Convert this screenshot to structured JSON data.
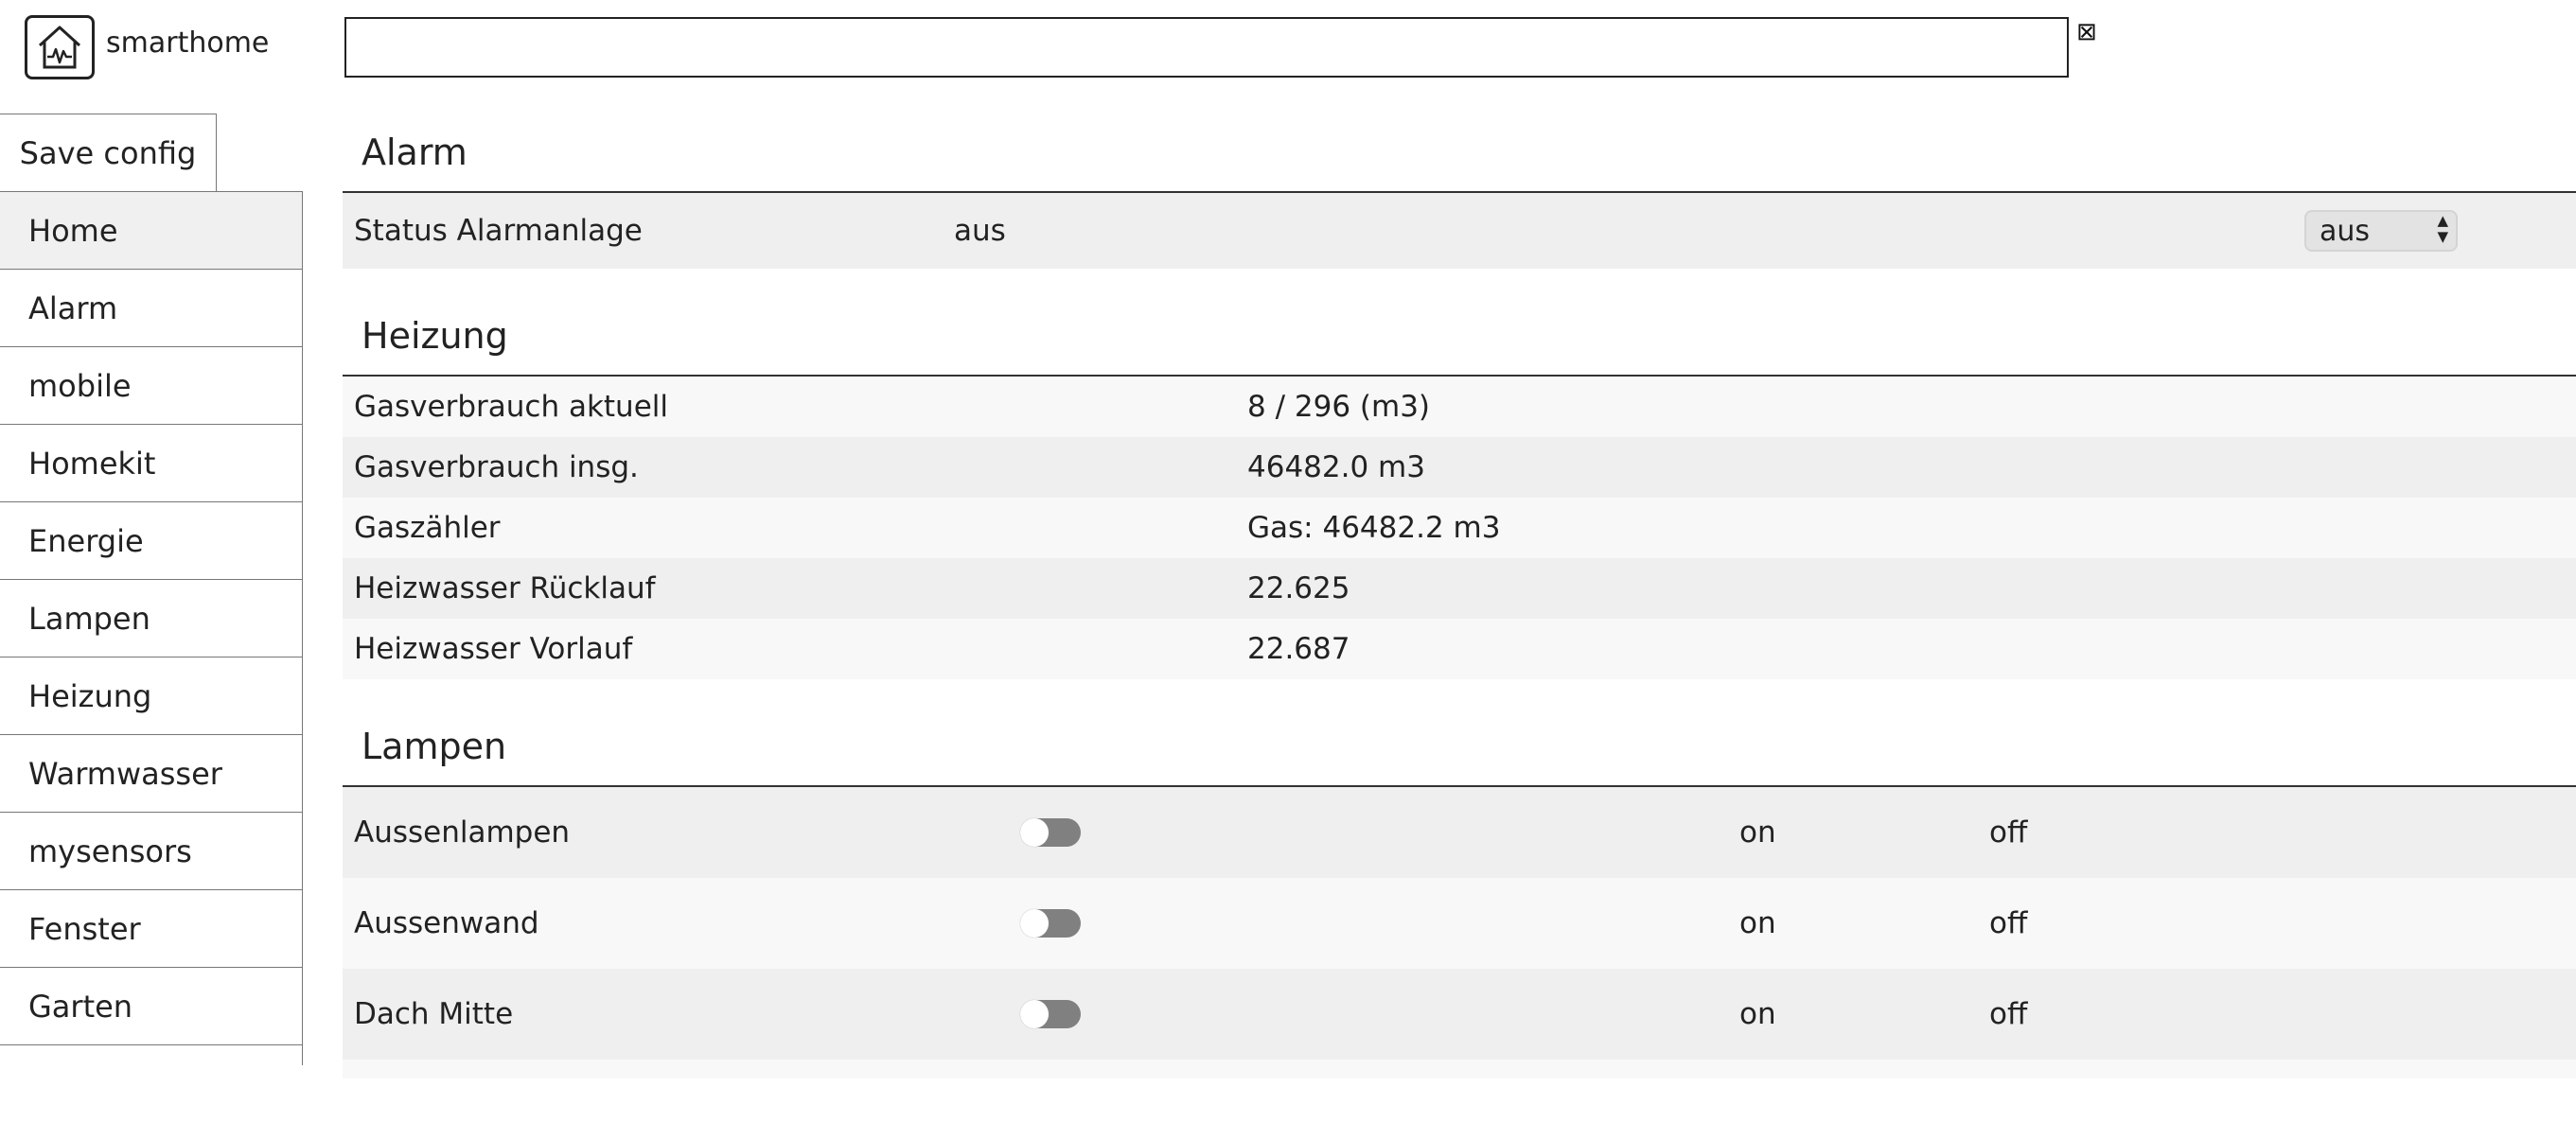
{
  "header": {
    "brand": "smarthome",
    "search_value": "",
    "clear_glyph": "⊠"
  },
  "toolbar": {
    "save_label": "Save config"
  },
  "sidebar": {
    "items": [
      {
        "label": "Home",
        "active": true
      },
      {
        "label": "Alarm"
      },
      {
        "label": "mobile"
      },
      {
        "label": "Homekit"
      },
      {
        "label": "Energie"
      },
      {
        "label": "Lampen"
      },
      {
        "label": "Heizung"
      },
      {
        "label": "Warmwasser"
      },
      {
        "label": "mysensors"
      },
      {
        "label": "Fenster"
      },
      {
        "label": "Garten"
      }
    ]
  },
  "alarm": {
    "title": "Alarm",
    "status_label": "Status Alarmanlage",
    "status_value": "aus",
    "select_value": "aus"
  },
  "heizung": {
    "title": "Heizung",
    "rows": [
      {
        "label": "Gasverbrauch aktuell",
        "value": "8 / 296 (m3)"
      },
      {
        "label": "Gasverbrauch insg.",
        "value": "46482.0 m3"
      },
      {
        "label": "Gaszähler",
        "value": "Gas: 46482.2 m3"
      },
      {
        "label": "Heizwasser Rücklauf",
        "value": "22.625"
      },
      {
        "label": "Heizwasser Vorlauf",
        "value": "22.687"
      }
    ]
  },
  "lampen": {
    "title": "Lampen",
    "rows": [
      {
        "label": "Aussenlampen",
        "on_label": "on",
        "off_label": "off",
        "state": "off"
      },
      {
        "label": "Aussenwand",
        "on_label": "on",
        "off_label": "off",
        "state": "off"
      },
      {
        "label": "Dach Mitte",
        "on_label": "on",
        "off_label": "off",
        "state": "off"
      }
    ]
  }
}
